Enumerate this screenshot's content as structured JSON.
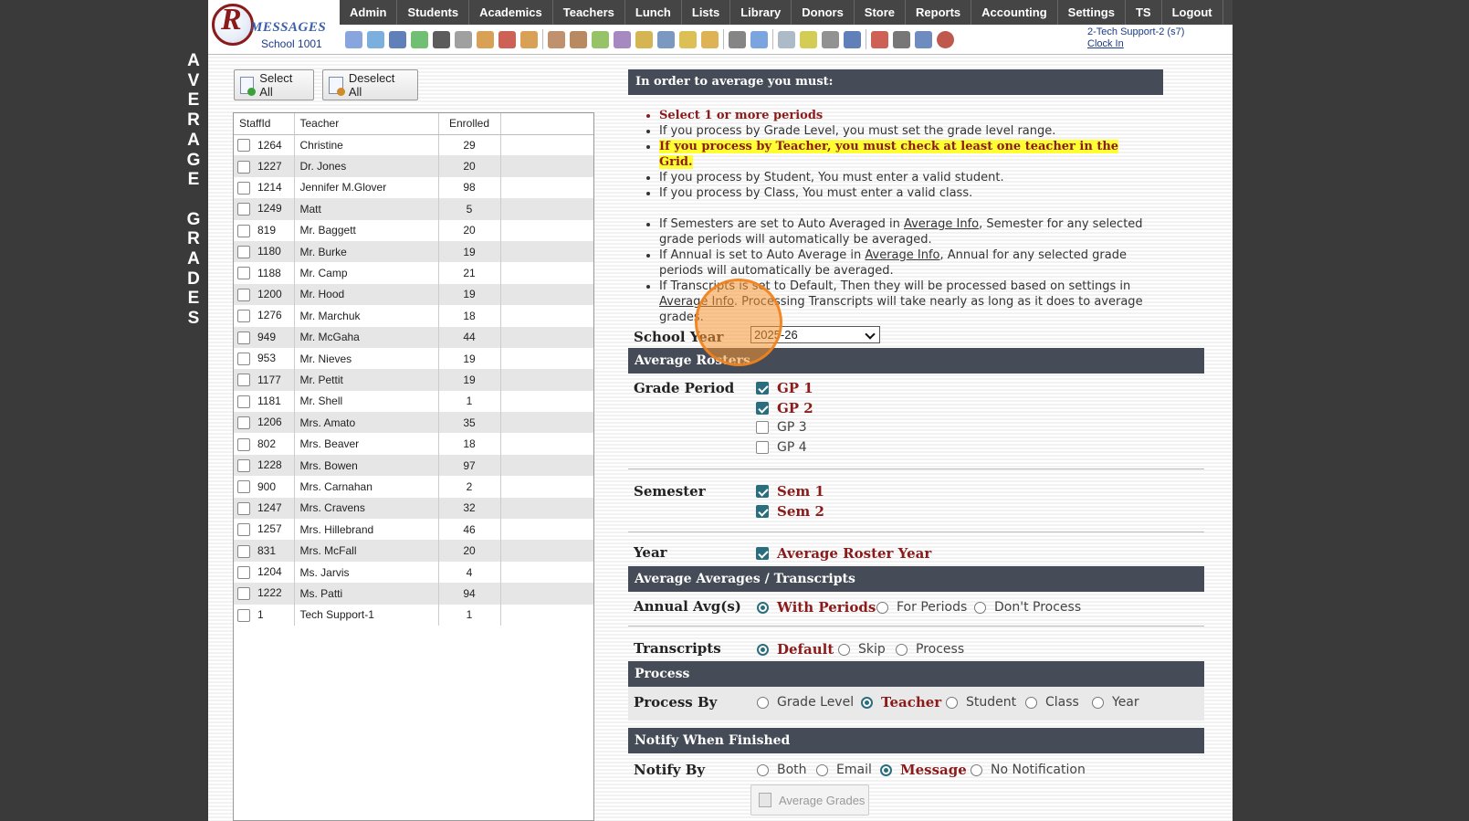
{
  "side_title": [
    "A",
    "V",
    "E",
    "R",
    "A",
    "G",
    "E",
    " ",
    "G",
    "R",
    "A",
    "D",
    "E",
    "S"
  ],
  "logo": {
    "letter": "R",
    "text": "MESSAGES",
    "school": "School 1001"
  },
  "menu": [
    "Admin",
    "Students",
    "Academics",
    "Teachers",
    "Lunch",
    "Lists",
    "Library",
    "Donors",
    "Store",
    "Reports",
    "Accounting",
    "Settings",
    "TS",
    "Logout"
  ],
  "toolbar_icons": [
    "search-icon",
    "calendar-grid-icon",
    "at-icon",
    "chat-icon",
    "phone-icon",
    "speaker-icon",
    "gradebook-icon",
    "calendar-icon",
    "megaphone-icon",
    "sep",
    "teacher-icon",
    "student-icon",
    "money-icon",
    "users-icon",
    "lunch-icon",
    "book-icon",
    "tag-icon",
    "cart-icon",
    "sep",
    "person-icon",
    "clock-icon",
    "sep",
    "table-icon",
    "card-icon",
    "printer-icon",
    "ap-icon",
    "sep",
    "pdf-icon",
    "stack-icon",
    "help-icon",
    "power-icon"
  ],
  "user": {
    "name": "2-Tech Support-2 (s7)",
    "clock": "Clock In"
  },
  "buttons": {
    "select_all": "Select All",
    "deselect_all": "Deselect All",
    "average_grades": "Average Grades"
  },
  "grid": {
    "headers": [
      "StaffId",
      "Teacher",
      "Enrolled",
      ""
    ],
    "rows": [
      {
        "id": "1264",
        "name": "Christine",
        "enrolled": "29"
      },
      {
        "id": "1227",
        "name": "Dr. Jones",
        "enrolled": "20"
      },
      {
        "id": "1214",
        "name": "Jennifer M.Glover",
        "enrolled": "98"
      },
      {
        "id": "1249",
        "name": "Matt",
        "enrolled": "5"
      },
      {
        "id": "819",
        "name": "Mr. Baggett",
        "enrolled": "20"
      },
      {
        "id": "1180",
        "name": "Mr. Burke",
        "enrolled": "19"
      },
      {
        "id": "1188",
        "name": "Mr. Camp",
        "enrolled": "21"
      },
      {
        "id": "1200",
        "name": "Mr. Hood",
        "enrolled": "19"
      },
      {
        "id": "1276",
        "name": "Mr. Marchuk",
        "enrolled": "18"
      },
      {
        "id": "949",
        "name": "Mr. McGaha",
        "enrolled": "44"
      },
      {
        "id": "953",
        "name": "Mr. Nieves",
        "enrolled": "19"
      },
      {
        "id": "1177",
        "name": "Mr. Pettit",
        "enrolled": "19"
      },
      {
        "id": "1181",
        "name": "Mr. Shell",
        "enrolled": "1"
      },
      {
        "id": "1206",
        "name": "Mrs. Amato",
        "enrolled": "35"
      },
      {
        "id": "802",
        "name": "Mrs. Beaver",
        "enrolled": "18"
      },
      {
        "id": "1228",
        "name": "Mrs. Bowen",
        "enrolled": "97"
      },
      {
        "id": "900",
        "name": "Mrs. Carnahan",
        "enrolled": "2"
      },
      {
        "id": "1247",
        "name": "Mrs. Cravens",
        "enrolled": "32"
      },
      {
        "id": "1257",
        "name": "Mrs. Hillebrand",
        "enrolled": "46"
      },
      {
        "id": "831",
        "name": "Mrs. McFall",
        "enrolled": "20"
      },
      {
        "id": "1204",
        "name": "Ms. Jarvis",
        "enrolled": "4"
      },
      {
        "id": "1222",
        "name": "Ms. Patti",
        "enrolled": "94"
      },
      {
        "id": "1",
        "name": "Tech Support-1",
        "enrolled": "1"
      }
    ]
  },
  "info": {
    "title": "In order to average you must:",
    "req1": "Select 1 or more periods",
    "req2": "If you process by Grade Level, you must set the grade level range.",
    "req3": "If you process by Teacher, you must check at least one teacher in the Grid.",
    "req4": "If you process by Student, You must enter a valid student.",
    "req5": "If you process by Class, You must enter a valid class.",
    "note1_a": "If Semesters are set to Auto Averaged in ",
    "note1_link": "Average Info",
    "note1_b": ", Semester for any selected grade periods will automatically be averaged.",
    "note2_a": "If Annual is set to Auto Average in ",
    "note2_link": "Average Info",
    "note2_b": ", Annual for any selected grade periods will automatically be averaged.",
    "note3_a": "If Transcripts is set to Default, Then they will be processed based on settings in ",
    "note3_link": "Average Info",
    "note3_b": ". Processing Transcripts will take nearly as long as it does to average grades."
  },
  "form": {
    "school_year_label": "School Year",
    "school_year_value": "2025-26",
    "sect_rosters": "Average Rosters",
    "grade_period_label": "Grade Period",
    "grade_periods": [
      {
        "label": "GP 1",
        "checked": true
      },
      {
        "label": "GP 2",
        "checked": true
      },
      {
        "label": "GP 3",
        "checked": false
      },
      {
        "label": "GP 4",
        "checked": false
      }
    ],
    "semester_label": "Semester",
    "semesters": [
      {
        "label": "Sem 1",
        "checked": true
      },
      {
        "label": "Sem 2",
        "checked": true
      }
    ],
    "year_label": "Year",
    "year_option": "Average Roster Year",
    "sect_averages": "Average Averages / Transcripts",
    "annual_label": "Annual Avg(s)",
    "annual_options": [
      "With Periods",
      "For Periods",
      "Don't Process"
    ],
    "transcripts_label": "Transcripts",
    "transcripts_options": [
      "Default",
      "Skip",
      "Process"
    ],
    "sect_process": "Process",
    "process_by_label": "Process By",
    "process_by_options": [
      "Grade Level",
      "Teacher",
      "Student",
      "Class",
      "Year"
    ],
    "sect_notify": "Notify When Finished",
    "notify_by_label": "Notify By",
    "notify_options": [
      "Both",
      "Email",
      "Message",
      "No Notification"
    ]
  },
  "colors": {
    "accent": "#8b1a1a",
    "header_bar": "#454c57",
    "menu_bar": "#454545",
    "highlight": "#ffff33",
    "radio": "#2a6d7d"
  }
}
